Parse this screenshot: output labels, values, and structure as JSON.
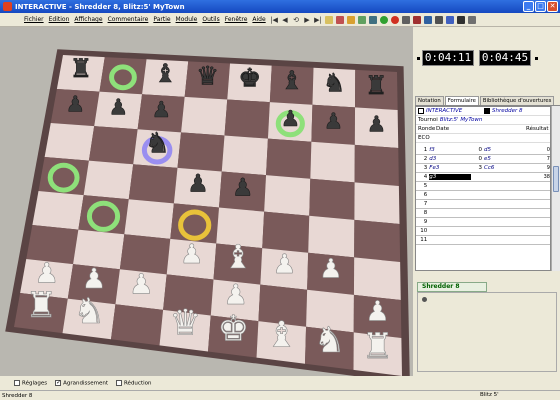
{
  "window": {
    "title": "INTERACTIVE - Shredder 8, Blitz:5' MyTown"
  },
  "menu": [
    "Fichier",
    "Edition",
    "Affichage",
    "Commentaire",
    "Partie",
    "Module",
    "Outils",
    "Fenêtre",
    "Aide"
  ],
  "toolbar": {
    "nav": [
      "|◀",
      "◀",
      "⟲",
      "▶",
      "▶|"
    ],
    "icons": [
      "new-game",
      "flip-board",
      "hint",
      "analyze",
      "search",
      "go",
      "stop",
      "setup",
      "database",
      "edit",
      "print",
      "engine",
      "options",
      "sound"
    ]
  },
  "clocks": {
    "white": "0:04:11",
    "black": "0:04:45"
  },
  "tabs": [
    "Notation",
    "Formulaire",
    "Bibliothèque d'ouvertures"
  ],
  "active_tab": "Formulaire",
  "game": {
    "white": "INTERACTIVE",
    "black": "Shredder 8",
    "tournament_label": "Tournoi",
    "tournament": "Blitz:5' MyTown",
    "round_label": "Ronde",
    "date_label": "Date",
    "result_label": "Résultat",
    "eco_label": "ECO",
    "moves": [
      {
        "n": "1",
        "w": "f3",
        "b": "d5",
        "bnum": "0",
        "eval": "0"
      },
      {
        "n": "2",
        "w": "d3",
        "b": "e5",
        "bnum": "0",
        "eval": "7"
      },
      {
        "n": "3",
        "w": "Fe3",
        "b": "Cc6",
        "bnum": "3",
        "eval": "9"
      },
      {
        "n": "4",
        "w": "g3",
        "b": "",
        "bnum": "",
        "eval": "38"
      },
      {
        "n": "5",
        "w": "",
        "b": "",
        "bnum": "",
        "eval": ""
      },
      {
        "n": "6",
        "w": "",
        "b": "",
        "bnum": "",
        "eval": ""
      },
      {
        "n": "7",
        "w": "",
        "b": "",
        "bnum": "",
        "eval": ""
      },
      {
        "n": "8",
        "w": "",
        "b": "",
        "bnum": "",
        "eval": ""
      },
      {
        "n": "9",
        "w": "",
        "b": "",
        "bnum": "",
        "eval": ""
      },
      {
        "n": "10",
        "w": "",
        "b": "",
        "bnum": "",
        "eval": ""
      },
      {
        "n": "11",
        "w": "",
        "b": "",
        "bnum": "",
        "eval": ""
      }
    ]
  },
  "engine": {
    "name": "Shredder 8"
  },
  "bottom_options": [
    {
      "label": "Réglages",
      "checked": false
    },
    {
      "label": "Agrandissement",
      "checked": true
    },
    {
      "label": "Réduction",
      "checked": false
    }
  ],
  "status": {
    "left": "Shredder 8",
    "right": "Blitz 5'"
  },
  "board": {
    "pieces": [
      [
        "bR",
        "",
        "bB",
        "bQ",
        "bK",
        "bB",
        "bN",
        "bR"
      ],
      [
        "bP",
        "bP",
        "bP",
        "",
        "",
        "bP",
        "bP",
        "bP"
      ],
      [
        "",
        "",
        "bN",
        "",
        "",
        "",
        "",
        ""
      ],
      [
        "",
        "",
        "",
        "bP",
        "bP",
        "",
        "",
        ""
      ],
      [
        "",
        "",
        "",
        "",
        "",
        "",
        "",
        ""
      ],
      [
        "",
        "",
        "",
        "wP",
        "wB",
        "wP",
        "wP",
        ""
      ],
      [
        "wP",
        "wP",
        "wP",
        "",
        "wP",
        "",
        "",
        "wP"
      ],
      [
        "wR",
        "wN",
        "",
        "wQ",
        "wK",
        "wB",
        "wN",
        "wR"
      ]
    ],
    "markers": [
      {
        "row": 0,
        "col": 1,
        "color": "#8ee07a"
      },
      {
        "row": 1,
        "col": 5,
        "color": "#8ee07a"
      },
      {
        "row": 2,
        "col": 2,
        "color": "#9a8ef0"
      },
      {
        "row": 3,
        "col": 0,
        "color": "#8ee07a"
      },
      {
        "row": 4,
        "col": 1,
        "color": "#8ee07a"
      },
      {
        "row": 4,
        "col": 3,
        "color": "#e8c23a"
      }
    ]
  },
  "colors": {
    "light_square": "#e8d8d4",
    "dark_square": "#7a5a5a"
  }
}
